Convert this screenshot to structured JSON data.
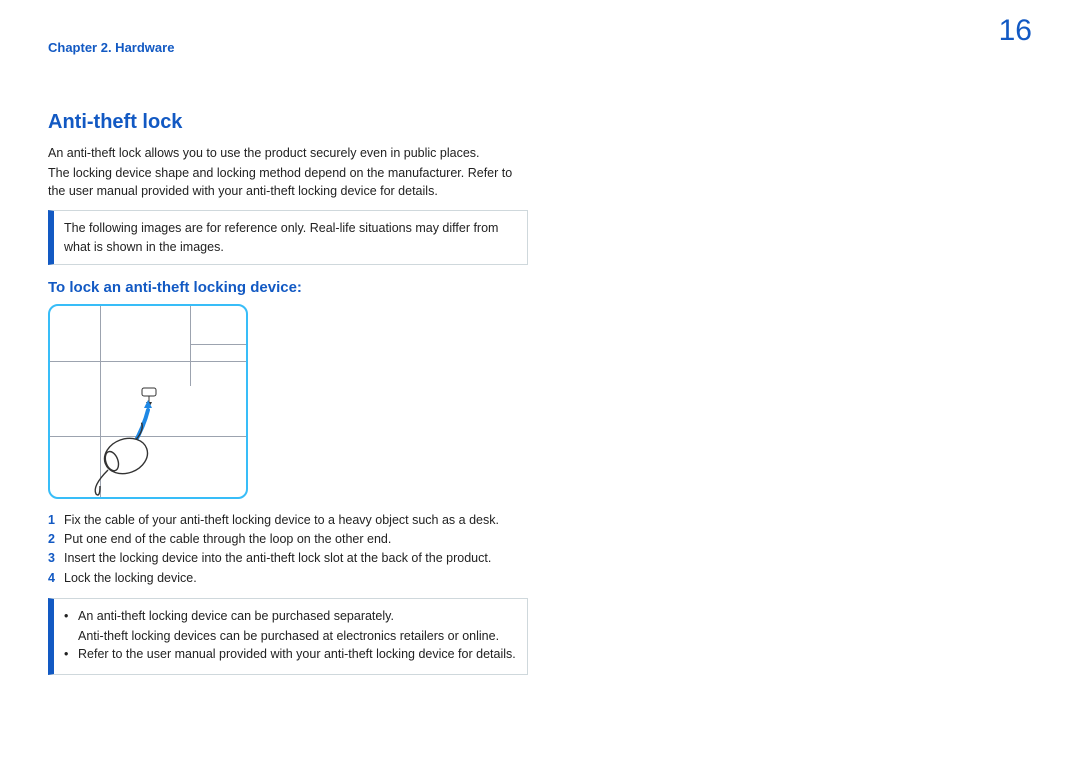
{
  "header": {
    "chapter": "Chapter 2. Hardware",
    "page_number": "16"
  },
  "title": "Anti-theft lock",
  "intro": {
    "p1": "An anti-theft lock allows you to use the product securely even in public places.",
    "p2": "The locking device shape and locking method depend on the manufacturer. Refer to the user manual provided with your anti-theft locking device for details."
  },
  "note1": "The following images are for reference only. Real-life situations may differ from what is shown in the images.",
  "subheading": "To lock an anti-theft locking device:",
  "steps": [
    "Fix the cable of your anti-theft locking device to a heavy object such as a desk.",
    "Put one end of the cable through the loop on the other end.",
    "Insert the locking device into the anti-theft lock slot at the back of the product.",
    "Lock the locking device."
  ],
  "note2": {
    "b1": "An anti-theft locking device can be purchased separately.",
    "b1_sub": "Anti-theft locking devices can be purchased at electronics retailers or online.",
    "b2": "Refer to the user manual provided with your anti-theft locking device for details."
  }
}
